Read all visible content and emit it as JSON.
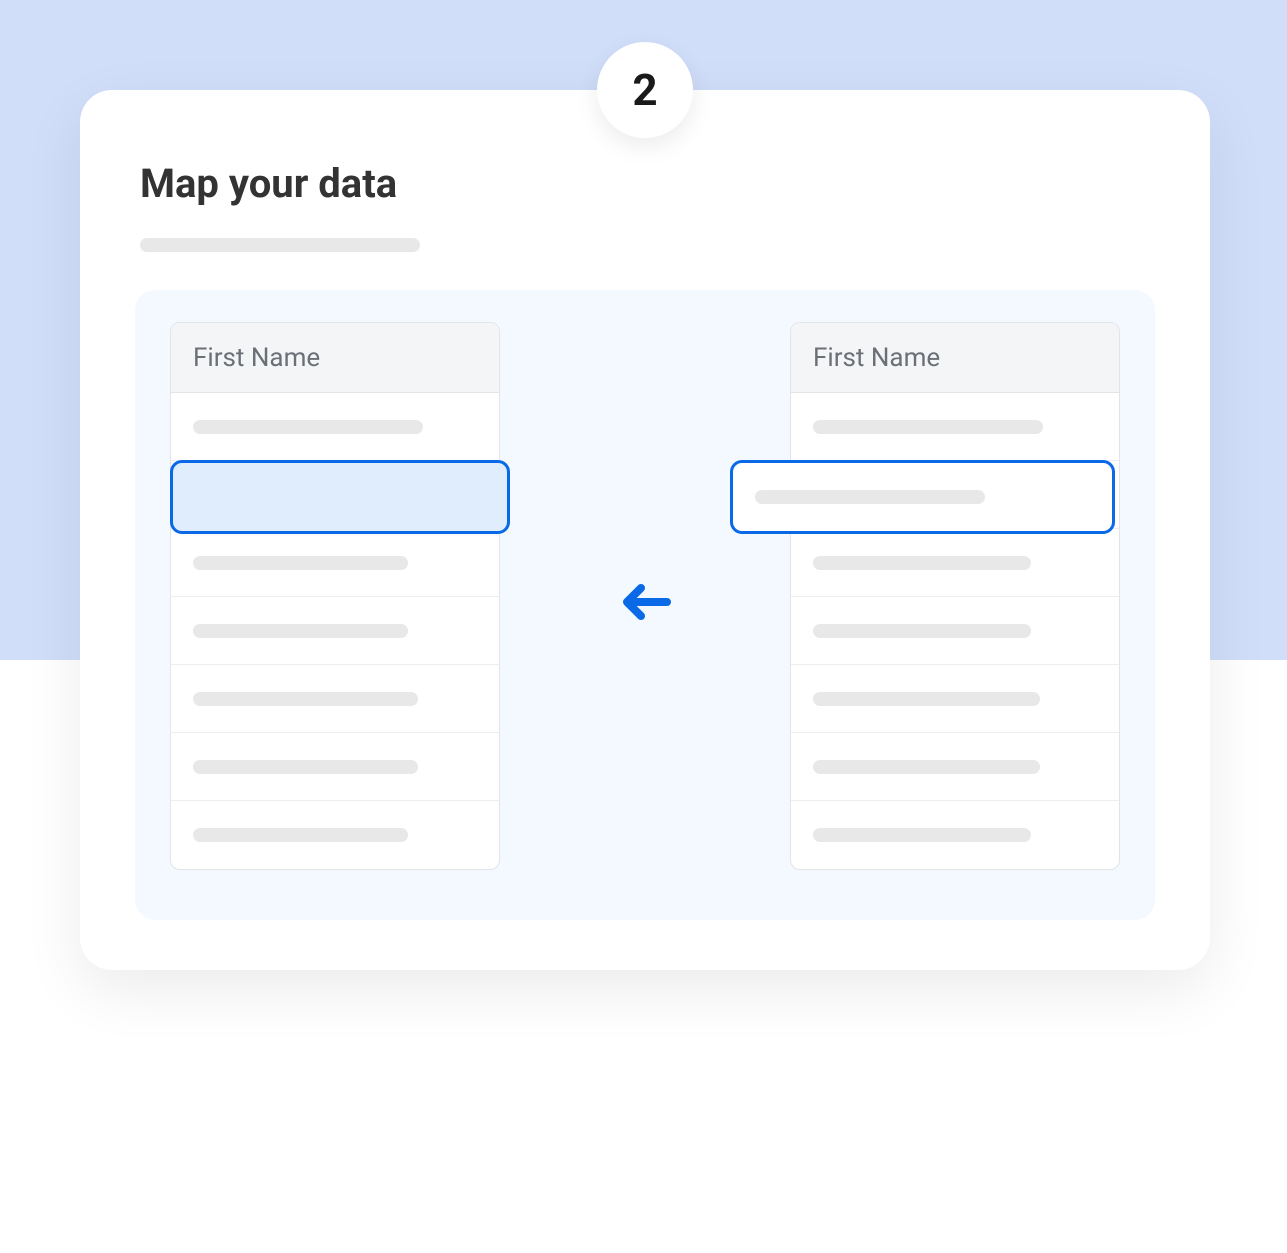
{
  "step": {
    "number": "2",
    "title": "Map your data"
  },
  "columns": {
    "left": {
      "header": "First Name"
    },
    "right": {
      "header": "First Name"
    }
  }
}
